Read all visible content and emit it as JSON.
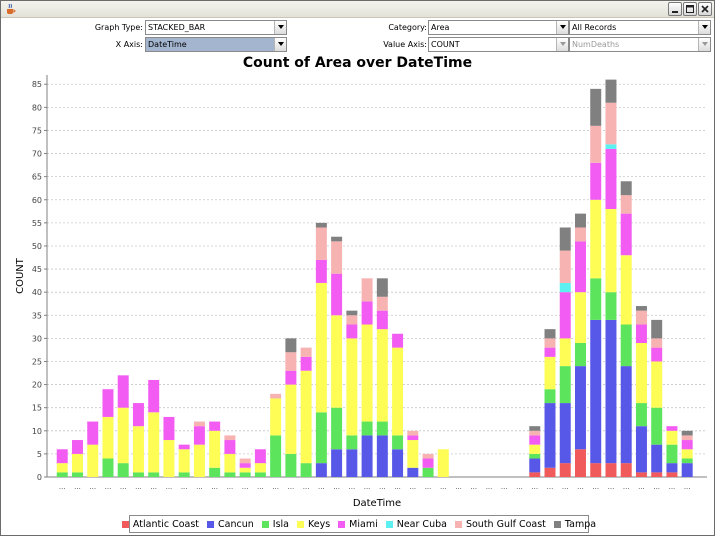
{
  "window": {
    "icon": "java-cup-icon",
    "buttons": [
      "minimize",
      "maximize",
      "close"
    ]
  },
  "controls": {
    "graph_type_label": "Graph Type:",
    "graph_type_value": "STACKED_BAR",
    "x_axis_label": "X Axis:",
    "x_axis_value": "DateTime",
    "category_label": "Category:",
    "category_value": "Area",
    "records_value": "All Records",
    "value_axis_label": "Value Axis:",
    "value_axis_value": "COUNT",
    "value_field_value": "NumDeaths"
  },
  "colors": {
    "Atlantic Coast": "#f05a5a",
    "Cancun": "#5858e8",
    "Isla": "#5ce45c",
    "Keys": "#fdfd55",
    "Miami": "#f25cf2",
    "Near Cuba": "#5cf0f0",
    "South Gulf Coast": "#f7b2b2",
    "Tampa": "#808080"
  },
  "chart_data": {
    "type": "bar",
    "stacked": true,
    "title": "Count of Area over DateTime",
    "xlabel": "DateTime",
    "ylabel": "COUNT",
    "ylim": [
      0,
      87
    ],
    "yticks": [
      0,
      5,
      10,
      15,
      20,
      25,
      30,
      35,
      40,
      45,
      50,
      55,
      60,
      65,
      70,
      75,
      80,
      85
    ],
    "grid": true,
    "legend_position": "bottom",
    "x_tick_label": "...",
    "series_names": [
      "Atlantic Coast",
      "Cancun",
      "Isla",
      "Keys",
      "Miami",
      "Near Cuba",
      "South Gulf Coast",
      "Tampa"
    ],
    "series": [
      {
        "name": "Atlantic Coast",
        "values": [
          0,
          0,
          0,
          0,
          0,
          0,
          0,
          0,
          0,
          0,
          0,
          0,
          0,
          0,
          0,
          0,
          0,
          0,
          0,
          0,
          0,
          0,
          0,
          0,
          0,
          0,
          0,
          0,
          0,
          0,
          0,
          1,
          2,
          3,
          6,
          3,
          3,
          3,
          1,
          1,
          1,
          0
        ]
      },
      {
        "name": "Cancun",
        "values": [
          0,
          0,
          0,
          0,
          0,
          0,
          0,
          0,
          0,
          0,
          0,
          0,
          0,
          0,
          0,
          0,
          0,
          3,
          6,
          6,
          9,
          9,
          6,
          2,
          0,
          0,
          0,
          0,
          0,
          0,
          0,
          3,
          14,
          13,
          18,
          31,
          31,
          21,
          10,
          6,
          2,
          3
        ]
      },
      {
        "name": "Isla",
        "values": [
          1,
          1,
          0,
          4,
          3,
          1,
          1,
          0,
          1,
          0,
          2,
          1,
          1,
          1,
          9,
          5,
          3,
          11,
          9,
          3,
          3,
          3,
          3,
          0,
          2,
          0,
          0,
          0,
          0,
          0,
          0,
          1,
          3,
          8,
          5,
          9,
          6,
          9,
          5,
          8,
          4,
          1
        ]
      },
      {
        "name": "Keys",
        "values": [
          2,
          4,
          7,
          9,
          12,
          10,
          13,
          8,
          5,
          7,
          8,
          4,
          1,
          2,
          8,
          15,
          20,
          28,
          20,
          21,
          21,
          20,
          19,
          6,
          0,
          6,
          0,
          0,
          0,
          0,
          0,
          2,
          7,
          6,
          11,
          17,
          18,
          15,
          13,
          10,
          3,
          2
        ]
      },
      {
        "name": "Miami",
        "values": [
          3,
          3,
          5,
          6,
          7,
          5,
          7,
          5,
          1,
          4,
          2,
          3,
          1,
          3,
          0,
          3,
          3,
          5,
          9,
          3,
          5,
          4,
          3,
          1,
          2,
          0,
          0,
          0,
          0,
          0,
          0,
          2,
          2,
          10,
          11,
          8,
          13,
          9,
          4,
          3,
          1,
          2
        ]
      },
      {
        "name": "Near Cuba",
        "values": [
          0,
          0,
          0,
          0,
          0,
          0,
          0,
          0,
          0,
          0,
          0,
          0,
          0,
          0,
          0,
          0,
          0,
          0,
          0,
          0,
          0,
          0,
          0,
          0,
          0,
          0,
          0,
          0,
          0,
          0,
          0,
          0,
          0,
          2,
          0,
          0,
          1,
          0,
          0,
          0,
          0,
          0
        ]
      },
      {
        "name": "South Gulf Coast",
        "values": [
          0,
          0,
          0,
          0,
          0,
          0,
          0,
          0,
          0,
          1,
          0,
          1,
          1,
          0,
          1,
          4,
          2,
          7,
          7,
          2,
          5,
          3,
          0,
          1,
          1,
          0,
          0,
          0,
          0,
          0,
          0,
          1,
          2,
          7,
          3,
          8,
          9,
          4,
          3,
          2,
          0,
          1
        ]
      },
      {
        "name": "Tampa",
        "values": [
          0,
          0,
          0,
          0,
          0,
          0,
          0,
          0,
          0,
          0,
          0,
          0,
          0,
          0,
          0,
          3,
          0,
          1,
          1,
          1,
          0,
          4,
          0,
          0,
          0,
          0,
          0,
          0,
          0,
          0,
          0,
          1,
          2,
          5,
          3,
          8,
          5,
          3,
          1,
          4,
          0,
          1
        ]
      }
    ]
  }
}
